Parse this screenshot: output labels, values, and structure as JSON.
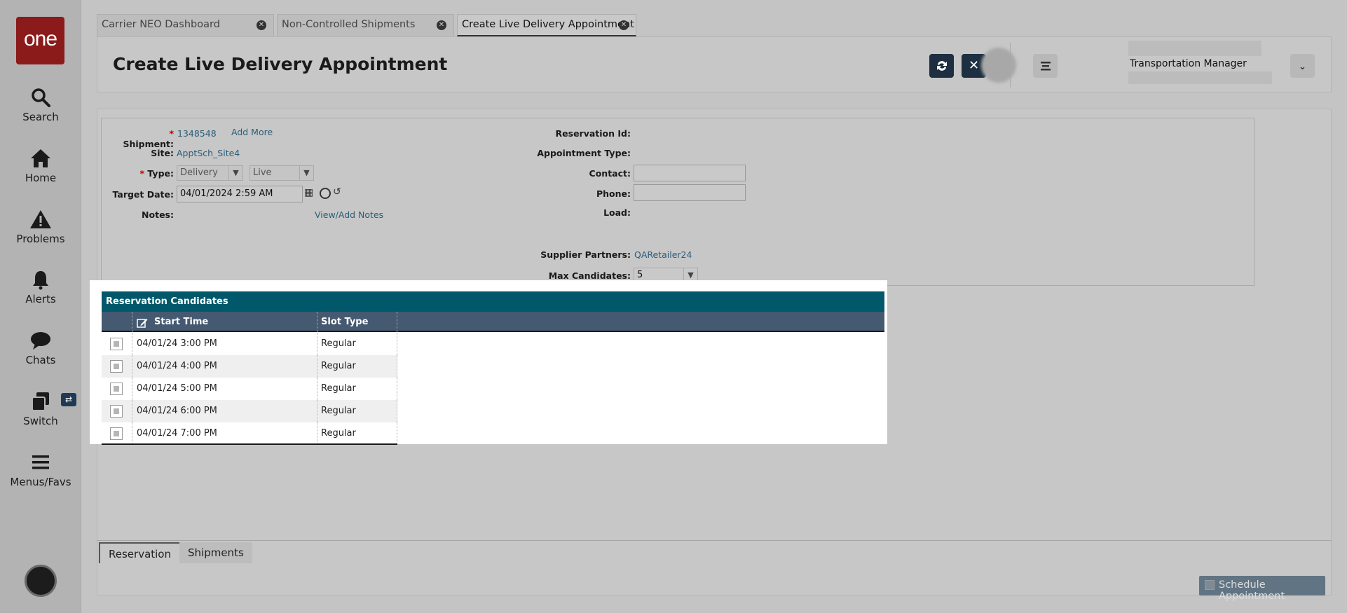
{
  "nav": {
    "logo": "one",
    "items": [
      {
        "label": "Search"
      },
      {
        "label": "Home"
      },
      {
        "label": "Problems"
      },
      {
        "label": "Alerts"
      },
      {
        "label": "Chats"
      },
      {
        "label": "Switch"
      },
      {
        "label": "Menus/Favs"
      }
    ]
  },
  "tabs": [
    {
      "label": "Carrier NEO Dashboard"
    },
    {
      "label": "Non-Controlled Shipments"
    },
    {
      "label": "Create Live Delivery Appointment"
    }
  ],
  "header": {
    "title": "Create Live Delivery Appointment",
    "user_role": "Transportation Manager"
  },
  "form": {
    "shipment_label": "Shipment:",
    "shipment_value": "1348548",
    "add_more": "Add More",
    "site_label": "Site:",
    "site_value": "ApptSch_Site4",
    "type_label": "Type:",
    "type_value": "Delivery",
    "type_mode": "Live",
    "target_date_label": "Target Date:",
    "target_date_value": "04/01/2024 2:59 AM",
    "notes_label": "Notes:",
    "view_add_notes": "View/Add Notes",
    "reservation_id_label": "Reservation Id:",
    "appointment_type_label": "Appointment Type:",
    "contact_label": "Contact:",
    "phone_label": "Phone:",
    "load_label": "Load:",
    "supplier_partners_label": "Supplier Partners:",
    "supplier_partners_value": "QARetailer24",
    "max_candidates_label": "Max Candidates:",
    "max_candidates_value": "5"
  },
  "grid": {
    "title": "Reservation Candidates",
    "columns": [
      "Start Time",
      "Slot Type"
    ],
    "rows": [
      {
        "start_time": "04/01/24 3:00 PM",
        "slot_type": "Regular"
      },
      {
        "start_time": "04/01/24 4:00 PM",
        "slot_type": "Regular"
      },
      {
        "start_time": "04/01/24 5:00 PM",
        "slot_type": "Regular"
      },
      {
        "start_time": "04/01/24 6:00 PM",
        "slot_type": "Regular"
      },
      {
        "start_time": "04/01/24 7:00 PM",
        "slot_type": "Regular"
      }
    ]
  },
  "bottom_tabs": [
    {
      "label": "Reservation"
    },
    {
      "label": "Shipments"
    }
  ],
  "actions": {
    "schedule": "Schedule Appointment"
  }
}
